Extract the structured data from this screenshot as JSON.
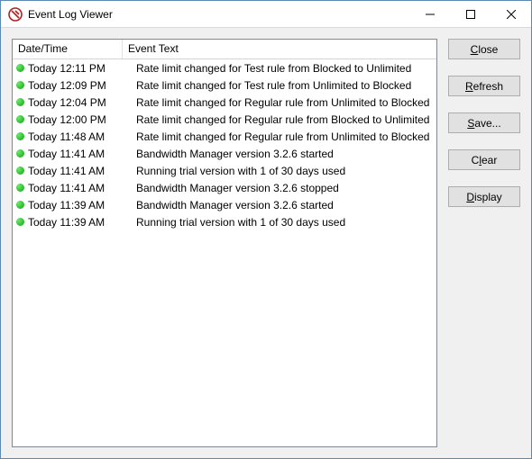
{
  "window": {
    "title": "Event Log Viewer"
  },
  "columns": {
    "date": "Date/Time",
    "text": "Event Text"
  },
  "buttons": {
    "close": "Close",
    "close_u": "C",
    "refresh": "Refresh",
    "refresh_u": "R",
    "save": "Save...",
    "save_u": "S",
    "clear": "Clear",
    "clear_u": "l",
    "display": "Display",
    "display_u": "D"
  },
  "events": [
    {
      "datetime": "Today 12:11 PM",
      "text": "Rate limit changed for Test rule from Blocked to Unlimited"
    },
    {
      "datetime": "Today 12:09 PM",
      "text": "Rate limit changed for Test rule from Unlimited to Blocked"
    },
    {
      "datetime": "Today 12:04 PM",
      "text": "Rate limit changed for Regular rule from Unlimited to Blocked"
    },
    {
      "datetime": "Today 12:00 PM",
      "text": "Rate limit changed for Regular rule from Blocked to Unlimited"
    },
    {
      "datetime": "Today 11:48 AM",
      "text": "Rate limit changed for Regular rule from Unlimited to Blocked"
    },
    {
      "datetime": "Today 11:41 AM",
      "text": "Bandwidth Manager version 3.2.6 started"
    },
    {
      "datetime": "Today 11:41 AM",
      "text": "Running trial version with 1 of 30 days used"
    },
    {
      "datetime": "Today 11:41 AM",
      "text": "Bandwidth Manager version 3.2.6 stopped"
    },
    {
      "datetime": "Today 11:39 AM",
      "text": "Bandwidth Manager version 3.2.6 started"
    },
    {
      "datetime": "Today 11:39 AM",
      "text": "Running trial version with 1 of 30 days used"
    }
  ]
}
